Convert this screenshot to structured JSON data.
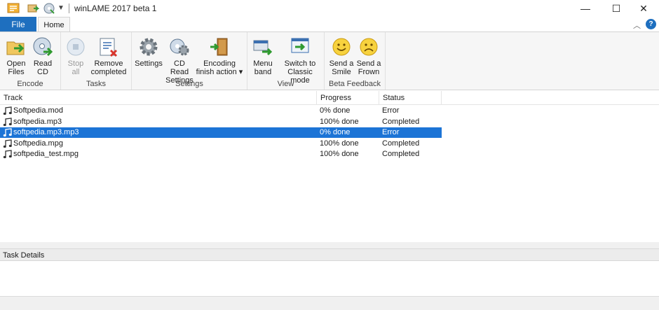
{
  "window": {
    "title": "winLAME 2017 beta 1",
    "controls": {
      "minimize": "—",
      "maximize": "☐",
      "close": "✕"
    }
  },
  "tabs": {
    "file": "File",
    "home": "Home"
  },
  "ribbon": {
    "groups": [
      {
        "label": "Encode",
        "buttons": [
          {
            "line1": "Open",
            "line2": "Files",
            "icon": "open-files-icon",
            "enabled": true
          },
          {
            "line1": "Read",
            "line2": "CD",
            "icon": "read-cd-icon",
            "enabled": true
          }
        ]
      },
      {
        "label": "Tasks",
        "buttons": [
          {
            "line1": "Stop",
            "line2": "all",
            "icon": "stop-icon",
            "enabled": false
          },
          {
            "line1": "Remove",
            "line2": "completed",
            "icon": "remove-completed-icon",
            "enabled": true
          }
        ]
      },
      {
        "label": "Settings",
        "buttons": [
          {
            "line1": "Settings",
            "line2": "",
            "icon": "gear-icon",
            "enabled": true
          },
          {
            "line1": "CD Read",
            "line2": "Settings",
            "icon": "cd-gear-icon",
            "enabled": true
          },
          {
            "line1": "Encoding",
            "line2": "finish action ▾",
            "icon": "exit-door-icon",
            "enabled": true
          }
        ]
      },
      {
        "label": "View",
        "buttons": [
          {
            "line1": "Menu",
            "line2": "band",
            "icon": "menu-band-icon",
            "enabled": true
          },
          {
            "line1": "Switch to",
            "line2": "Classic mode",
            "icon": "classic-mode-icon",
            "enabled": true
          }
        ]
      },
      {
        "label": "Beta Feedback",
        "buttons": [
          {
            "line1": "Send a",
            "line2": "Smile",
            "icon": "smile-icon",
            "enabled": true
          },
          {
            "line1": "Send a",
            "line2": "Frown",
            "icon": "frown-icon",
            "enabled": true
          }
        ]
      }
    ]
  },
  "tracklist": {
    "columns": [
      "Track",
      "Progress",
      "Status"
    ],
    "rows": [
      {
        "track": "Softpedia.mod",
        "progress": "0% done",
        "status": "Error",
        "selected": false
      },
      {
        "track": "softpedia.mp3",
        "progress": "100% done",
        "status": "Completed",
        "selected": false
      },
      {
        "track": "softpedia.mp3.mp3",
        "progress": "0% done",
        "status": "Error",
        "selected": true
      },
      {
        "track": "Softpedia.mpg",
        "progress": "100% done",
        "status": "Completed",
        "selected": false
      },
      {
        "track": "softpedia_test.mpg",
        "progress": "100% done",
        "status": "Completed",
        "selected": false
      }
    ]
  },
  "task_details": {
    "title": "Task Details"
  },
  "colors": {
    "accent": "#1e6fbf",
    "selection": "#1c74d6",
    "ribbon_bg": "#f6f6f6"
  }
}
